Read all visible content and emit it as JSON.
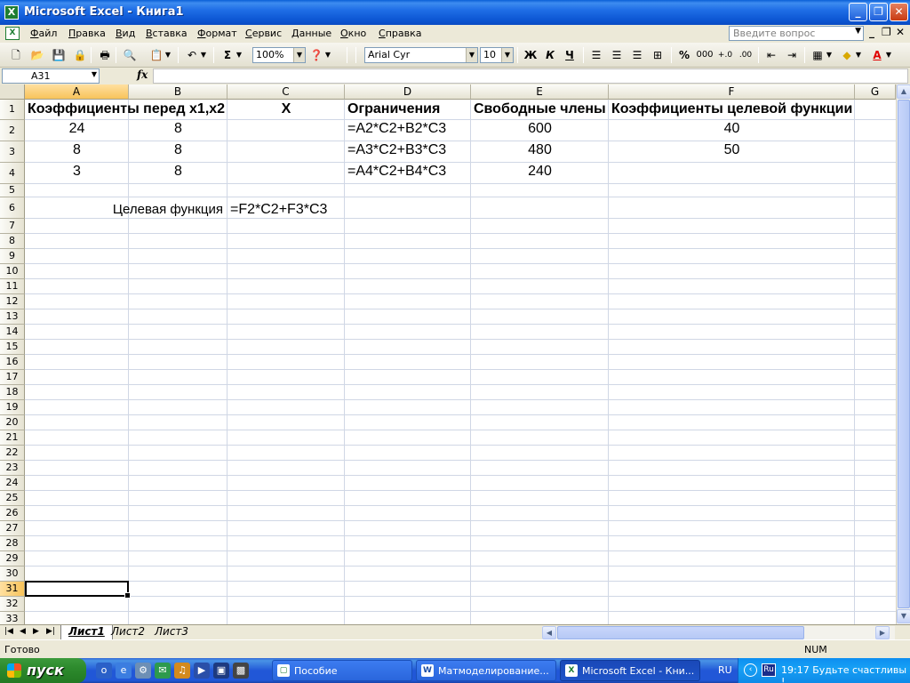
{
  "window": {
    "title": "Microsoft Excel - Книга1"
  },
  "menu": [
    "Файл",
    "Правка",
    "Вид",
    "Вставка",
    "Формат",
    "Сервис",
    "Данные",
    "Окно",
    "Справка"
  ],
  "ask_placeholder": "Введите вопрос",
  "toolbar": {
    "zoom": "100%",
    "font": "Arial Cyr",
    "font_size": "10",
    "bold": "Ж",
    "italic": "К",
    "underline": "Ч",
    "percent": "%",
    "thousands": "000",
    "sum": "Σ"
  },
  "namebox": "A31",
  "fx_label": "fx",
  "columns": [
    "A",
    "B",
    "C",
    "D",
    "E",
    "F",
    "G"
  ],
  "rows": [
    "1",
    "2",
    "3",
    "4",
    "5",
    "6",
    "7",
    "8",
    "9",
    "10",
    "11",
    "12",
    "13",
    "14",
    "15",
    "16",
    "17",
    "18",
    "19",
    "20",
    "21",
    "22",
    "23",
    "24",
    "25",
    "26",
    "27",
    "28",
    "29",
    "30",
    "31",
    "32",
    "33"
  ],
  "cells": {
    "A1": "Коэффициенты перед x1,x2",
    "C1": "X",
    "D1": "Ограничения",
    "E1": "Свободные члены",
    "F1": "Коэффициенты целевой функции",
    "A2": "24",
    "B2": "8",
    "D2": "=A2*C2+B2*C3",
    "E2": "600",
    "F2": "40",
    "A3": "8",
    "B3": "8",
    "D3": "=A3*C2+B3*C3",
    "E3": "480",
    "F3": "50",
    "A4": "3",
    "B4": "8",
    "D4": "=A4*C2+B4*C3",
    "E4": "240",
    "B6": "Целевая функция",
    "C6": "=F2*C2+F3*C3"
  },
  "sheets": [
    "Лист1",
    "Лист2",
    "Лист3"
  ],
  "active_sheet": "Лист1",
  "status": {
    "text": "Готово",
    "num": "NUM"
  },
  "taskbar": {
    "start": "пуск",
    "tasks": [
      "Пособие",
      "Матмоделирование...",
      "Microsoft Excel - Кни..."
    ],
    "lang": "RU",
    "tray_lang": "Ru",
    "clock": "19:17 Будьте счастливы !"
  }
}
